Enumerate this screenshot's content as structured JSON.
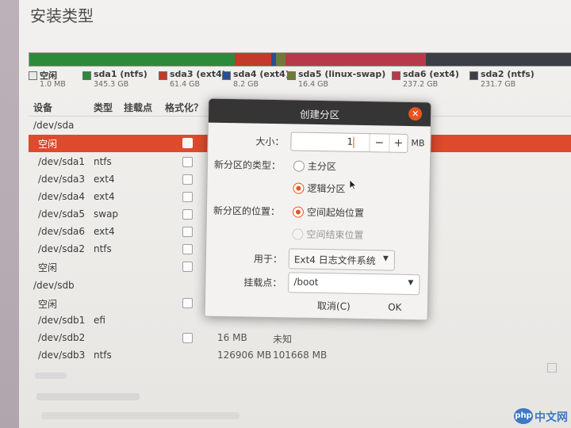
{
  "page": {
    "title": "安装类型"
  },
  "colors": {
    "accent": "#e95420",
    "selected_row": "#dd4a2c"
  },
  "disk_bar": {
    "segments": [
      {
        "name": "空闲",
        "color": "#f0f0f0",
        "fraction": 0.0006
      },
      {
        "name": "sda1 (ntfs)",
        "color": "#2d8a3b",
        "fraction": 0.378
      },
      {
        "name": "sda3 (ext4)",
        "color": "#c23a2a",
        "fraction": 0.067
      },
      {
        "name": "sda4 (ext4)",
        "color": "#2a4f8f",
        "fraction": 0.009
      },
      {
        "name": "sda5 (linux-swap)",
        "color": "#6f7a3a",
        "fraction": 0.018
      },
      {
        "name": "sda6 (ext4)",
        "color": "#b83a4a",
        "fraction": 0.259
      },
      {
        "name": "sda2 (ntfs)",
        "color": "#3c3f46",
        "fraction": 0.268
      }
    ]
  },
  "legend": [
    {
      "name": "空闲",
      "size": "1.0 MB",
      "color": "#e8e8e8"
    },
    {
      "name": "sda1 (ntfs)",
      "size": "345.3 GB",
      "color": "#2d8a3b"
    },
    {
      "name": "sda3 (ext4)",
      "size": "61.4 GB",
      "color": "#c23a2a"
    },
    {
      "name": "sda4 (ext4)",
      "size": "8.2 GB",
      "color": "#2a4f8f"
    },
    {
      "name": "sda5 (linux-swap)",
      "size": "16.4 GB",
      "color": "#6f7a3a"
    },
    {
      "name": "sda6 (ext4)",
      "size": "237.2 GB",
      "color": "#b83a4a"
    },
    {
      "name": "sda2 (ntfs)",
      "size": "231.7 GB",
      "color": "#3c3f46"
    }
  ],
  "table": {
    "headers": {
      "device": "设备",
      "type": "类型",
      "mount": "挂载点",
      "format": "格式化？"
    },
    "rows": [
      {
        "device": "/dev/sda",
        "type": "",
        "c1": "",
        "c2": "",
        "c3": ""
      },
      {
        "device": "空闲",
        "type": "",
        "c1": "",
        "c2": "",
        "c3": ""
      },
      {
        "device": "/dev/sda1",
        "type": "ntfs",
        "c1": "",
        "c2": "",
        "c3": ""
      },
      {
        "device": "/dev/sda3",
        "type": "ext4",
        "c1": "",
        "c2": "",
        "c3": ""
      },
      {
        "device": "/dev/sda4",
        "type": "ext4",
        "c1": "",
        "c2": "",
        "c3": ""
      },
      {
        "device": "/dev/sda5",
        "type": "swap",
        "c1": "",
        "c2": "",
        "c3": ""
      },
      {
        "device": "/dev/sda6",
        "type": "ext4",
        "c1": "",
        "c2": "",
        "c3": ""
      },
      {
        "device": "/dev/sda2",
        "type": "ntfs",
        "c1": "",
        "c2": "",
        "c3": ""
      },
      {
        "device": "空闲",
        "type": "",
        "c1": "",
        "c2": "",
        "c3": ""
      },
      {
        "device": "/dev/sdb",
        "type": "",
        "c1": "",
        "c2": "",
        "c3": ""
      },
      {
        "device": "空闲",
        "type": "",
        "c1": "",
        "c2": "",
        "c3": ""
      },
      {
        "device": "/dev/sdb1",
        "type": "efi",
        "c1": "",
        "c2": "",
        "c3": ""
      },
      {
        "device": "/dev/sdb2",
        "type": "",
        "c1": "16 MB",
        "c2": "未知",
        "c3": ""
      },
      {
        "device": "/dev/sdb3",
        "type": "ntfs",
        "c1": "126906 MB",
        "c2": "101668 MB",
        "c3": ""
      }
    ],
    "row_tail_sda3": "4)"
  },
  "dialog": {
    "title": "创建分区",
    "size_label": "大小：",
    "size_value": "1",
    "unit": "MB",
    "minus": "−",
    "plus": "+",
    "type_label": "新分区的类型：",
    "type_primary": "主分区",
    "type_logical": "逻辑分区",
    "location_label": "新分区的位置：",
    "location_start": "空间起始位置",
    "location_end": "空间结束位置",
    "use_label": "用于：",
    "use_value": "Ext4 日志文件系统",
    "mount_label": "挂载点：",
    "mount_value": "/boot",
    "cancel": "取消(C)",
    "ok": "OK"
  },
  "watermark": {
    "logo": "php",
    "text": "中文网"
  }
}
